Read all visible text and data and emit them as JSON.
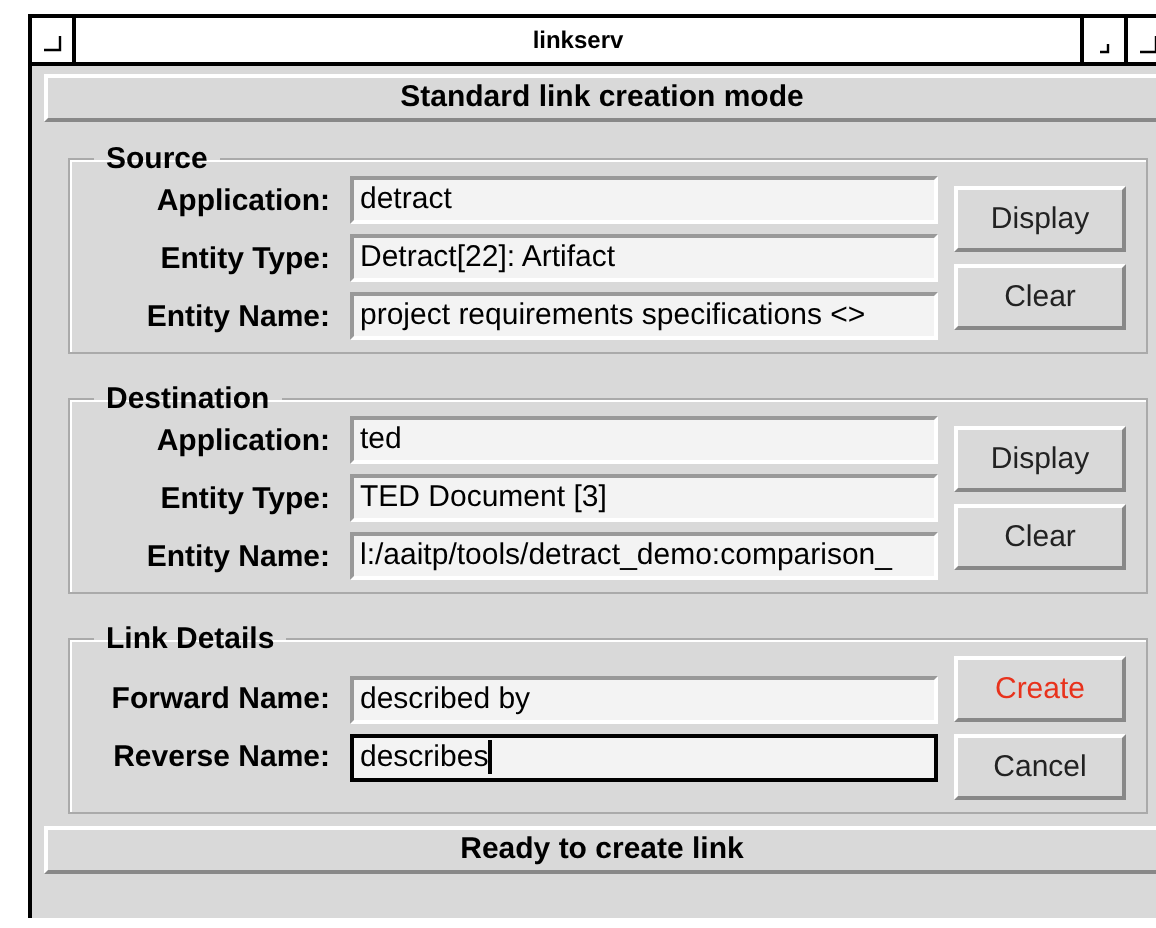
{
  "window": {
    "title": "linkserv"
  },
  "mode_banner": "Standard link creation mode",
  "sections": [
    {
      "title": "Source",
      "fields": [
        {
          "label": "Application:",
          "value": "detract",
          "focused": false
        },
        {
          "label": "Entity Type:",
          "value": "Detract[22]: Artifact",
          "focused": false
        },
        {
          "label": "Entity Name:",
          "value": "project requirements specifications <>",
          "focused": false
        }
      ],
      "buttons": [
        {
          "label": "Display",
          "default": false
        },
        {
          "label": "Clear",
          "default": false
        }
      ]
    },
    {
      "title": "Destination",
      "fields": [
        {
          "label": "Application:",
          "value": "ted",
          "focused": false
        },
        {
          "label": "Entity Type:",
          "value": "TED Document [3]",
          "focused": false
        },
        {
          "label": "Entity Name:",
          "value": "l:/aaitp/tools/detract_demo:comparison_",
          "focused": false
        }
      ],
      "buttons": [
        {
          "label": "Display",
          "default": false
        },
        {
          "label": "Clear",
          "default": false
        }
      ]
    },
    {
      "title": "Link Details",
      "fields": [
        {
          "label": "Forward Name:",
          "value": "described by",
          "focused": false
        },
        {
          "label": "Reverse Name:",
          "value": "describes",
          "focused": true
        }
      ],
      "buttons": [
        {
          "label": "Create",
          "default": true
        },
        {
          "label": "Cancel",
          "default": false
        }
      ]
    }
  ],
  "status_bar": "Ready to create link"
}
